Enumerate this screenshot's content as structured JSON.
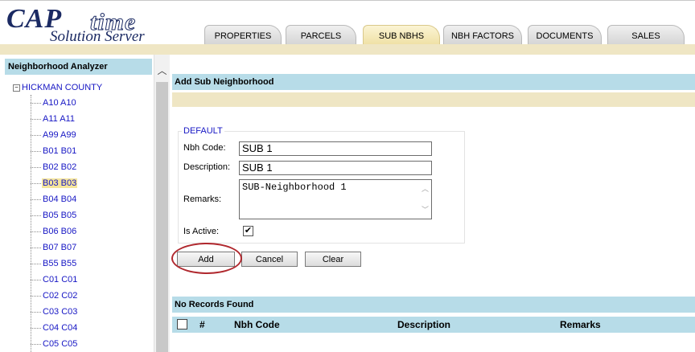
{
  "app": {
    "logo_cap": "CAP",
    "logo_time": "time",
    "logo_sub": "Solution Server"
  },
  "tabs": [
    {
      "label": "PROPERTIES",
      "active": false
    },
    {
      "label": "PARCELS",
      "active": false
    },
    {
      "label": "SUB NBHS",
      "active": true
    },
    {
      "label": "NBH FACTORS",
      "active": false
    },
    {
      "label": "DOCUMENTS",
      "active": false
    },
    {
      "label": "SALES",
      "active": false
    }
  ],
  "left_panel": {
    "title": "Neighborhood Analyzer",
    "root": {
      "expander": "−",
      "label": "HICKMAN COUNTY"
    },
    "nodes": [
      {
        "label": "A10 A10",
        "selected": false
      },
      {
        "label": "A11 A11",
        "selected": false
      },
      {
        "label": "A99 A99",
        "selected": false
      },
      {
        "label": "B01 B01",
        "selected": false
      },
      {
        "label": "B02 B02",
        "selected": false
      },
      {
        "label": "B03 B03",
        "selected": true
      },
      {
        "label": "B04 B04",
        "selected": false
      },
      {
        "label": "B05 B05",
        "selected": false
      },
      {
        "label": "B06 B06",
        "selected": false
      },
      {
        "label": "B07 B07",
        "selected": false
      },
      {
        "label": "B55 B55",
        "selected": false
      },
      {
        "label": "C01 C01",
        "selected": false
      },
      {
        "label": "C02 C02",
        "selected": false
      },
      {
        "label": "C03 C03",
        "selected": false
      },
      {
        "label": "C04 C04",
        "selected": false
      },
      {
        "label": "C05 C05",
        "selected": false
      }
    ]
  },
  "form": {
    "section_title": "Add Sub Neighborhood",
    "legend": "DEFAULT",
    "nbh_code_label": "Nbh Code:",
    "nbh_code_value": "SUB 1",
    "description_label": "Description:",
    "description_value": "SUB 1",
    "remarks_label": "Remarks:",
    "remarks_value": "SUB-Neighborhood 1",
    "is_active_label": "Is Active:",
    "is_active_checked": true,
    "check_mark": "✔",
    "add_label": "Add",
    "cancel_label": "Cancel",
    "clear_label": "Clear"
  },
  "records": {
    "status": "No Records Found",
    "columns": [
      "#",
      "Nbh Code",
      "Description",
      "Remarks"
    ]
  },
  "colors": {
    "accent_blue": "#b7dce8",
    "tan": "#efe6c4",
    "link_blue": "#1616c4",
    "highlight_oval": "#b0282e"
  }
}
